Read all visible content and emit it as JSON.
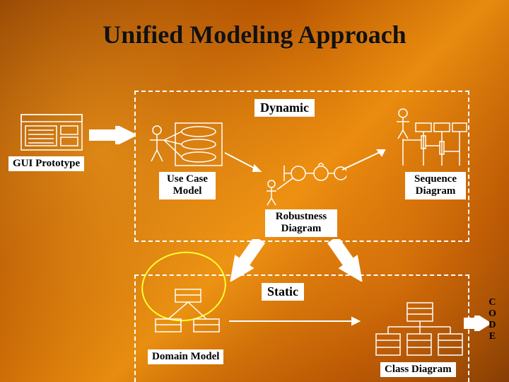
{
  "title": "Unified Modeling Approach",
  "sections": {
    "dynamic": "Dynamic",
    "static": "Static"
  },
  "nodes": {
    "gui": "GUI Prototype",
    "usecase": "Use Case\nModel",
    "sequence": "Sequence\nDiagram",
    "robustness": "Robustness\nDiagram",
    "domain": "Domain Model",
    "classdiag": "Class Diagram",
    "code": "C\nO\nD\nE"
  },
  "icons": {
    "gui": "gui-window-icon",
    "usecase": "usecase-actor-icon",
    "robustness": "robustness-icon",
    "sequence": "sequence-diagram-icon",
    "domain": "domain-boxes-icon",
    "classdiag": "class-diagram-icon"
  },
  "colors": {
    "accent": "#ffffff",
    "highlight": "#ffff33"
  },
  "chart_data": {
    "type": "diagram",
    "title": "Unified Modeling Approach",
    "groups": [
      {
        "name": "Dynamic",
        "members": [
          "Use Case Model",
          "Robustness Diagram",
          "Sequence Diagram"
        ]
      },
      {
        "name": "Static",
        "members": [
          "Domain Model",
          "Class Diagram"
        ]
      }
    ],
    "nodes": [
      "GUI Prototype",
      "Use Case Model",
      "Robustness Diagram",
      "Sequence Diagram",
      "Domain Model",
      "Class Diagram",
      "CODE"
    ],
    "edges": [
      {
        "from": "GUI Prototype",
        "to": "Use Case Model"
      },
      {
        "from": "Use Case Model",
        "to": "Robustness Diagram"
      },
      {
        "from": "Robustness Diagram",
        "to": "Sequence Diagram"
      },
      {
        "from": "Robustness Diagram",
        "to": "Domain Model"
      },
      {
        "from": "Robustness Diagram",
        "to": "Class Diagram"
      },
      {
        "from": "Domain Model",
        "to": "Class Diagram"
      },
      {
        "from": "Class Diagram",
        "to": "CODE"
      }
    ],
    "highlighted": [
      "Domain Model"
    ]
  }
}
